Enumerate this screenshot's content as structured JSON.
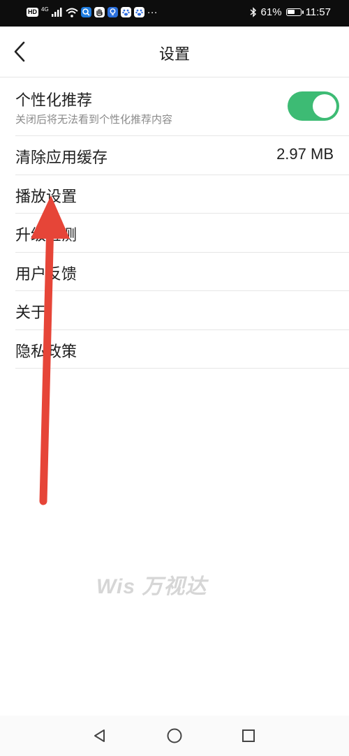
{
  "status_bar": {
    "hd_label": "HD",
    "network_label": "4G",
    "more_label": "···",
    "battery_text": "61%",
    "battery_level": 0.61,
    "time": "11:57"
  },
  "header": {
    "title": "设置",
    "back_icon": "chevron-left-icon"
  },
  "settings": {
    "personalized": {
      "label": "个性化推荐",
      "description": "关闭后将无法看到个性化推荐内容",
      "enabled": true,
      "toggle_color": "#3dbb74"
    },
    "clear_cache": {
      "label": "清除应用缓存",
      "value": "2.97 MB"
    },
    "items": [
      {
        "label": "播放设置"
      },
      {
        "label": "升级检测"
      },
      {
        "label": "用户反馈"
      },
      {
        "label": "关于"
      },
      {
        "label": "隐私政策"
      }
    ]
  },
  "annotation": {
    "color": "#e64538",
    "icon": "red-arrow"
  },
  "watermark": {
    "text": "Wis 万视达"
  },
  "nav_bar": {
    "back_icon": "triangle-back-icon",
    "home_icon": "circle-home-icon",
    "recents_icon": "square-recents-icon"
  }
}
